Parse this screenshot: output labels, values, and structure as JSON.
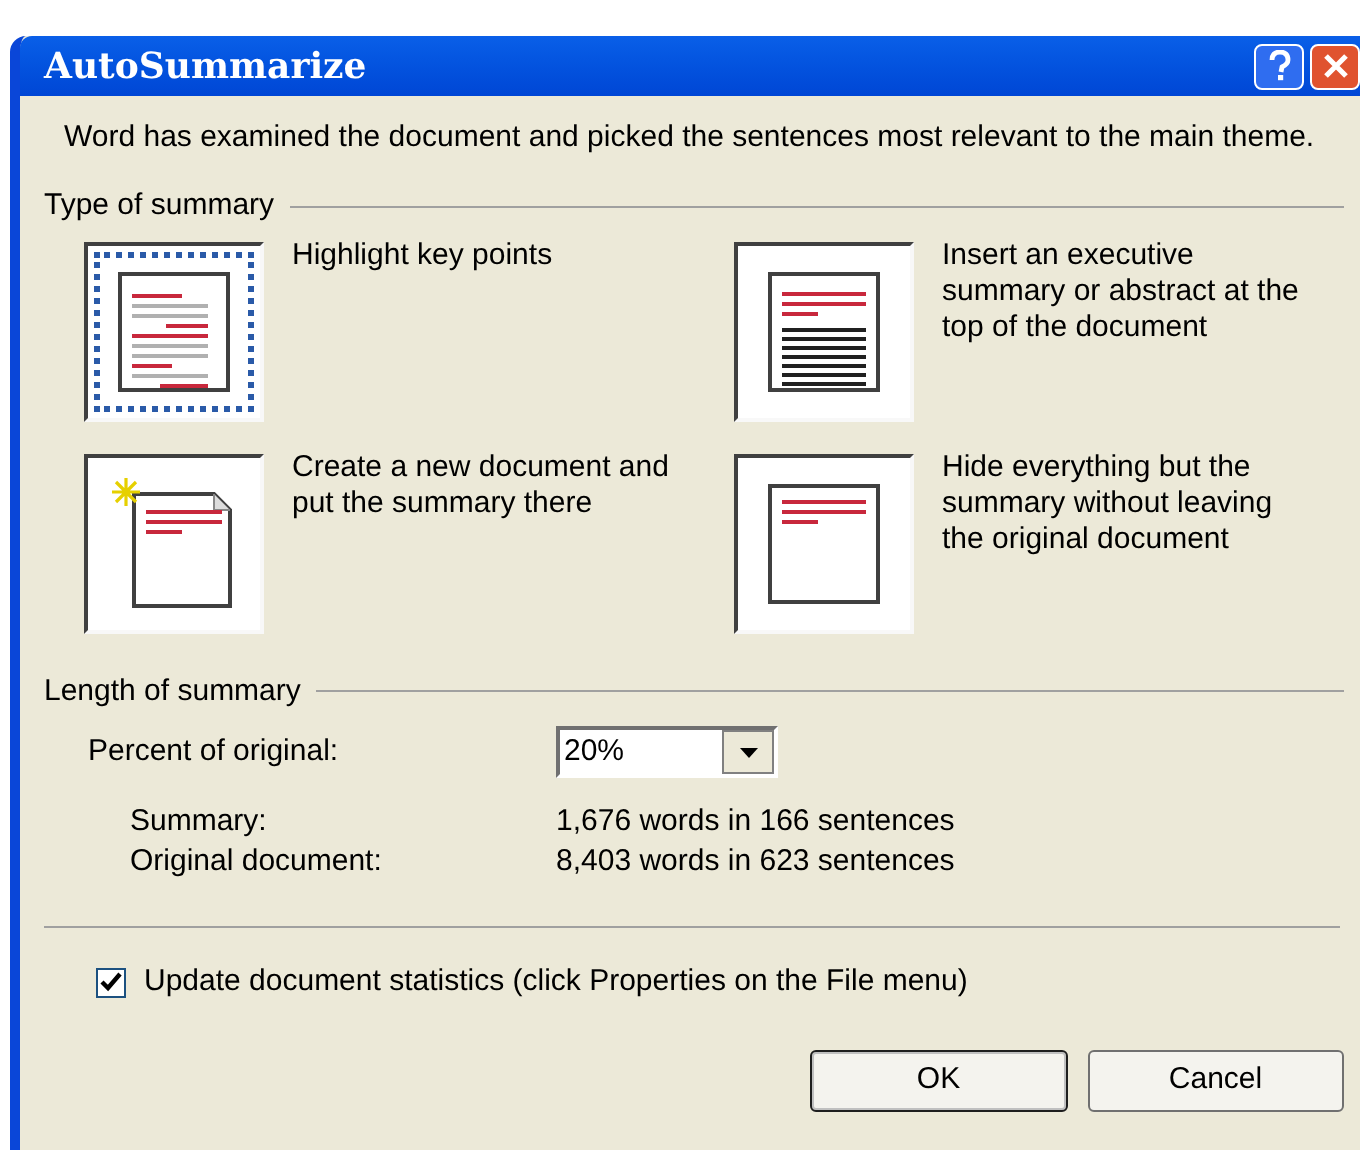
{
  "window": {
    "title": "AutoSummarize"
  },
  "intro": "Word has examined the document and picked the sentences most relevant to the main theme.",
  "type_of_summary": {
    "heading": "Type of summary",
    "options": [
      {
        "kind": "highlight",
        "label": "Highlight key points",
        "selected": true
      },
      {
        "kind": "insert",
        "label": "Insert an executive summary or abstract at the top of the document",
        "selected": false
      },
      {
        "kind": "new_document",
        "label": "Create a new document and put the summary there",
        "selected": false
      },
      {
        "kind": "hide",
        "label": "Hide everything but the summary without leaving the original document",
        "selected": false
      }
    ]
  },
  "length_of_summary": {
    "heading": "Length of summary",
    "percent_label": "Percent of original:",
    "percent_value": "20%",
    "stats": [
      {
        "label": "Summary:",
        "value": "1,676 words in 166 sentences"
      },
      {
        "label": "Original document:",
        "value": "8,403 words in 623 sentences"
      }
    ]
  },
  "update_statistics": {
    "label": "Update document statistics (click Properties on the File menu)",
    "checked": true
  },
  "buttons": [
    "OK",
    "Cancel"
  ]
}
